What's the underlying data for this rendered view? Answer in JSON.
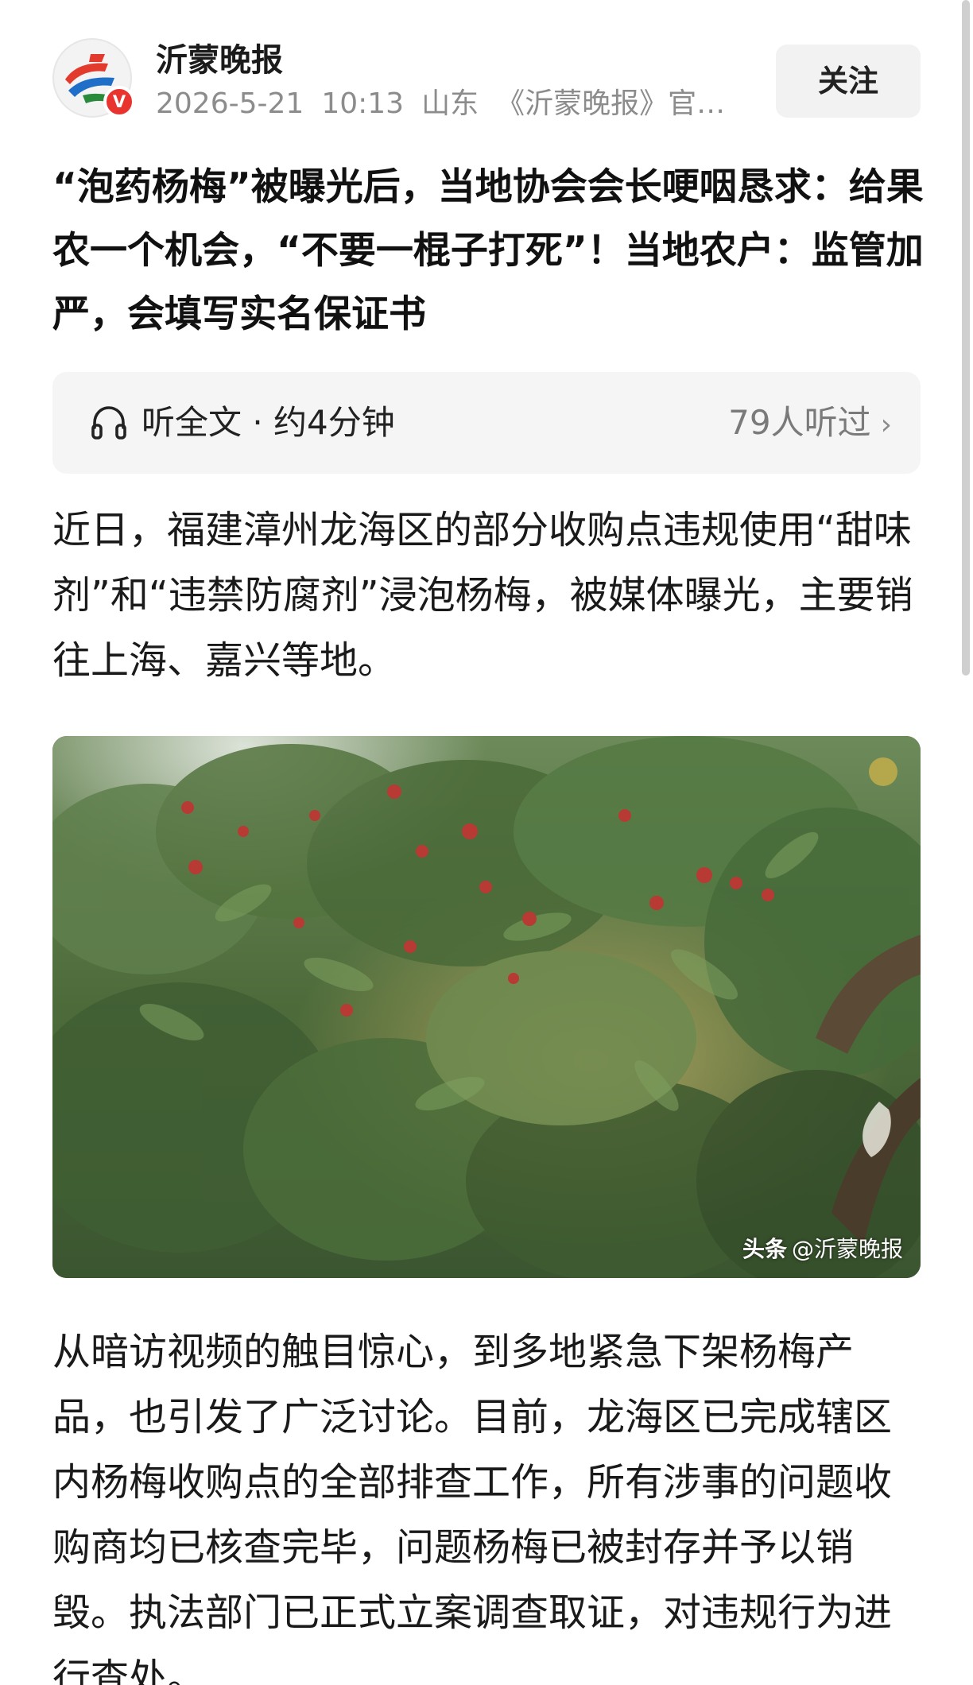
{
  "header": {
    "author_name": "沂蒙晚报",
    "verified_mark": "V",
    "date": "2026-5-21",
    "time": "10:13",
    "location": "山东",
    "account_desc": "《沂蒙晚报》官…",
    "follow_label": "关注"
  },
  "article": {
    "headline": "“泡药杨梅”被曝光后，当地协会会长哽咽恳求：给果农一个机会，“不要一棍子打死”！当地农户：监管加严，会填写实名保证书",
    "listen": {
      "label": "听全文 · 约4分钟",
      "listeners": "79人听过",
      "icon": "headphones-icon"
    },
    "paragraph_1": "近日，福建漳州龙海区的部分收购点违规使用“甜味剂”和“违禁防腐剂”浸泡杨梅，被媒体曝光，主要销往上海、嘉兴等地。",
    "image": {
      "watermark_brand": "头条",
      "watermark_account": "@沂蒙晚报"
    },
    "paragraph_2": "从暗访视频的触目惊心，到多地紧急下架杨梅产品，也引发了广泛讨论。目前，龙海区已完成辖区内杨梅收购点的全部排查工作，所有涉事的问题收购商均已核查完毕，问题杨梅已被封存并予以销毁。执法部门已正式立案调查取证，对违规行为进行查处。"
  },
  "colors": {
    "verified_badge": "#e8332f",
    "meta_text": "#8c8c8c",
    "listen_bar_bg": "#f5f5f5",
    "follow_bg": "#f2f2f2"
  }
}
